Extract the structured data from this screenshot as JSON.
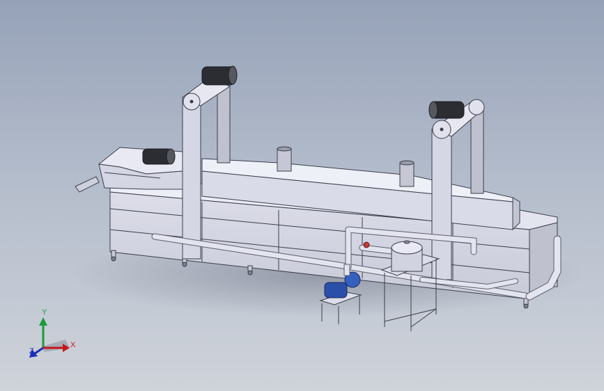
{
  "viewport": {
    "background_top": "#96a2b8",
    "background_bottom": "#cfd3da"
  },
  "model": {
    "frame_color": "#d8d9e6",
    "edge_color": "#3a3d4a",
    "motor_color": "#2b2d33",
    "pump_color": "#2b4fa8"
  },
  "triad": {
    "x_label": "X",
    "y_label": "Y",
    "z_label": "Z",
    "x_color": "#c4161c",
    "y_color": "#1a9a3a",
    "z_color": "#1b2fb8"
  }
}
